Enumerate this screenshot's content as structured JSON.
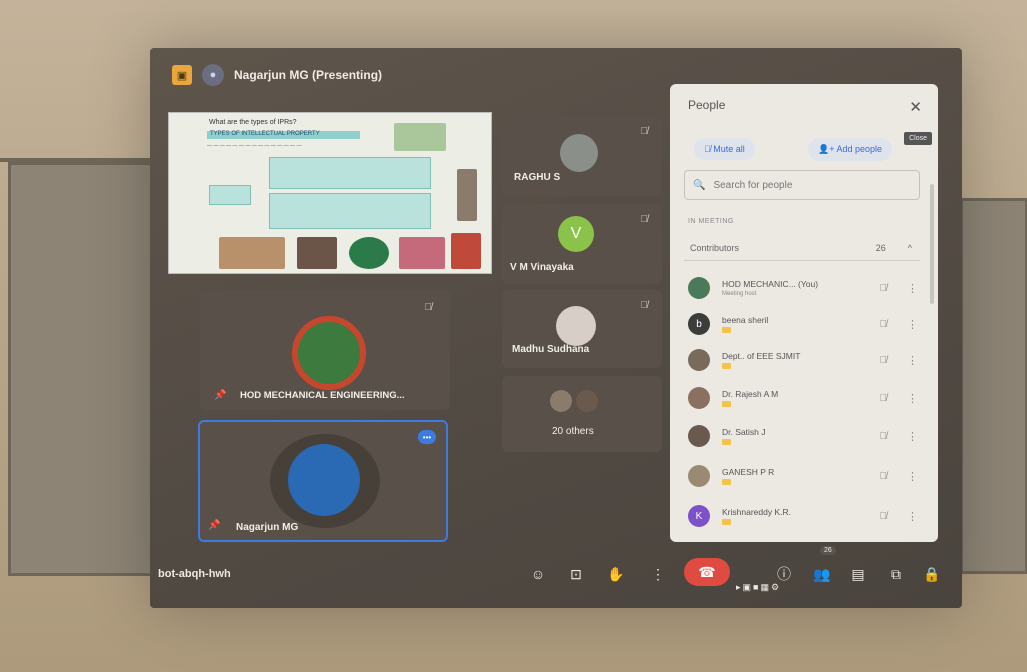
{
  "presenter": {
    "label": "Nagarjun MG (Presenting)"
  },
  "slide": {
    "question": "What are the types of IPRs?",
    "heading": "TYPES OF INTELLECTUAL PROPERTY"
  },
  "tiles": [
    {
      "name": "RAGHU S"
    },
    {
      "name": "V M Vinayaka",
      "avatar_letter": "V"
    },
    {
      "name": "Madhu Sudhana"
    },
    {
      "name": "20 others"
    },
    {
      "name": "HOD MECHANICAL ENGINEERING..."
    },
    {
      "name": "Nagarjun MG"
    }
  ],
  "people_panel": {
    "title": "People",
    "close_tooltip": "Close",
    "mute_all": "Mute all",
    "add_people": "Add people",
    "search_placeholder": "Search for people",
    "section": "IN MEETING",
    "group": "Contributors",
    "group_count": "26",
    "participants": [
      {
        "name": "HOD MECHANIC...  (You)",
        "sub": "Meeting host",
        "avatar_color": "#4a7a5a"
      },
      {
        "name": "beena sheril",
        "sub": "",
        "avatar_letter": "b",
        "avatar_color": "#3c3c3c"
      },
      {
        "name": "Dept.. of EEE SJMIT",
        "sub": "",
        "avatar_color": "#7a6a5a"
      },
      {
        "name": "Dr. Rajesh A M",
        "sub": "",
        "avatar_color": "#8a7060"
      },
      {
        "name": "Dr. Satish J",
        "sub": "",
        "avatar_color": "#6a5a4e"
      },
      {
        "name": "GANESH P R",
        "sub": "",
        "avatar_color": "#9a8a72"
      },
      {
        "name": "Krishnareddy K.R.",
        "sub": "",
        "avatar_letter": "K",
        "avatar_color": "#7b52c7"
      }
    ]
  },
  "bottom": {
    "meeting_code": "bot-abqh-hwh",
    "participants_badge": "26"
  },
  "colors": {
    "hangup": "#e04b41",
    "accent_blue": "#3a6bd8",
    "pinned_border": "#3d7be0"
  }
}
